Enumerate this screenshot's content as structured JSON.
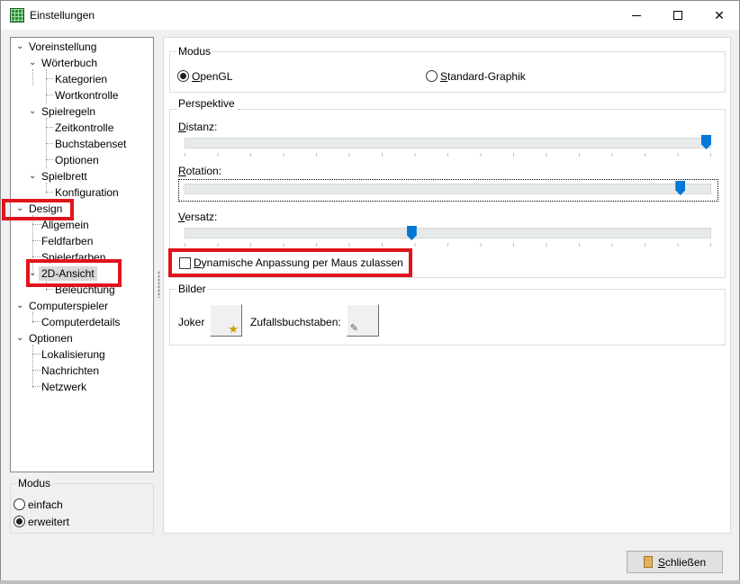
{
  "window": {
    "title": "Einstellungen"
  },
  "tree": {
    "items": [
      {
        "label": "Voreinstellung",
        "expanded": true
      },
      {
        "label": "Wörterbuch",
        "expanded": true
      },
      {
        "label": "Kategorien"
      },
      {
        "label": "Wortkontrolle"
      },
      {
        "label": "Spielregeln",
        "expanded": true
      },
      {
        "label": "Zeitkontrolle"
      },
      {
        "label": "Buchstabenset"
      },
      {
        "label": "Optionen"
      },
      {
        "label": "Spielbrett",
        "expanded": true
      },
      {
        "label": "Konfiguration"
      },
      {
        "label": "Design",
        "expanded": true
      },
      {
        "label": "Allgemein"
      },
      {
        "label": "Feldfarben"
      },
      {
        "label": "Spielerfarben"
      },
      {
        "label": "2D-Ansicht",
        "expanded": true,
        "selected": true
      },
      {
        "label": "Beleuchtung"
      },
      {
        "label": "Computerspieler",
        "expanded": true
      },
      {
        "label": "Computerdetails"
      },
      {
        "label": "Optionen",
        "expanded": true
      },
      {
        "label": "Lokalisierung"
      },
      {
        "label": "Nachrichten"
      },
      {
        "label": "Netzwerk"
      }
    ]
  },
  "mode": {
    "title": "Modus",
    "options": [
      {
        "label": "einfach",
        "checked": false
      },
      {
        "label": "erweitert",
        "checked": true
      }
    ]
  },
  "modus_group": {
    "title": "Modus",
    "opengl_first": "O",
    "opengl_rest": "penGL",
    "opengl_checked": true,
    "standard_first": "S",
    "standard_rest": "tandard-Graphik",
    "standard_checked": false
  },
  "perspektive": {
    "title": "Perspektive",
    "distanz_first": "D",
    "distanz_rest": "istanz:",
    "distanz_value": 1.0,
    "rotation_first": "R",
    "rotation_rest": "otation:",
    "rotation_value": 0.95,
    "versatz_first": "V",
    "versatz_rest": "ersatz:",
    "versatz_value": 0.43,
    "dyn_first": "D",
    "dyn_rest": "ynamische Anpassung per Maus zulassen",
    "dyn_checked": false
  },
  "bilder": {
    "title": "Bilder",
    "joker_label": "Joker",
    "joker_glyph": "★",
    "zufall_label": "Zufallsbuchstaben:",
    "zufall_glyph": "✎"
  },
  "footer": {
    "close_first": "S",
    "close_rest": "chließen"
  },
  "icons": {
    "close": "✕",
    "chevron": "⌄"
  },
  "colors": {
    "highlight": "#e0141c",
    "slider_thumb": "#0078d7"
  }
}
